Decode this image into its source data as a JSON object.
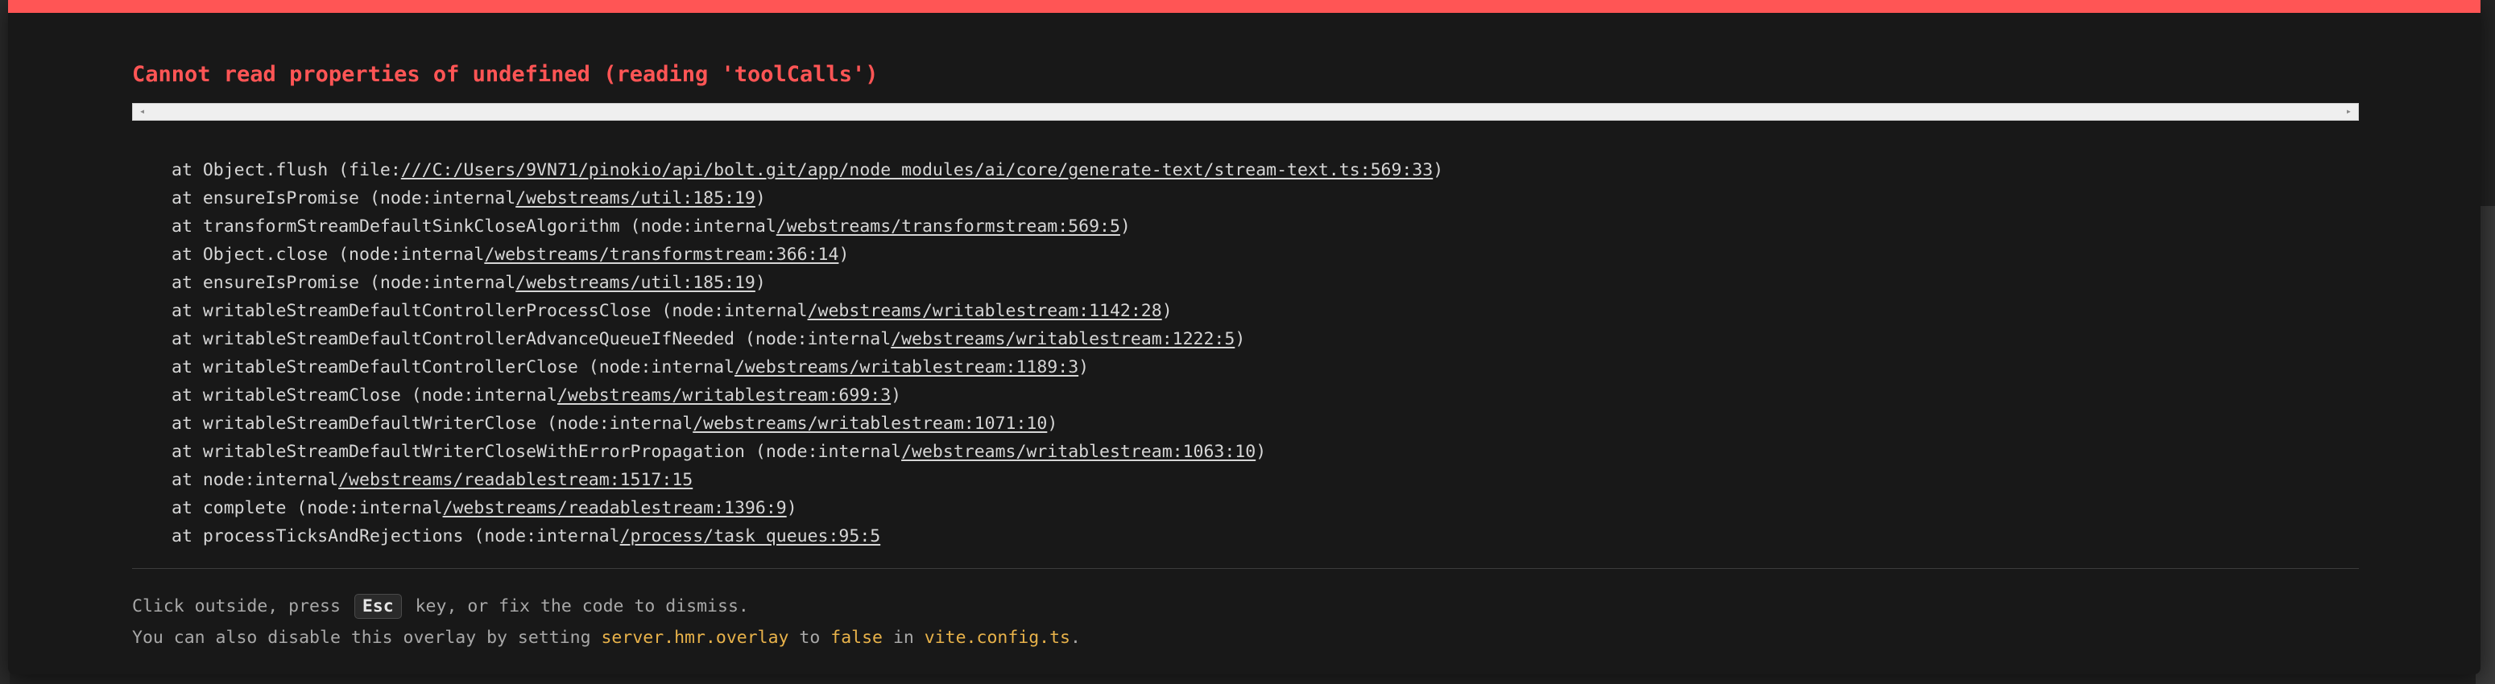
{
  "error": {
    "message": "Cannot read properties of undefined (reading 'toolCalls')"
  },
  "frame": {
    "scroll_left_label": "◂",
    "scroll_right_label": "▸"
  },
  "stack": [
    {
      "prefix": "at Object.flush (file:",
      "link": "///C:/Users/9VN71/pinokio/api/bolt.git/app/node_modules/ai/core/generate-text/stream-text.ts:569:33",
      "suffix": ")"
    },
    {
      "prefix": "at ensureIsPromise (node:internal",
      "link": "/webstreams/util:185:19",
      "suffix": ")"
    },
    {
      "prefix": "at transformStreamDefaultSinkCloseAlgorithm (node:internal",
      "link": "/webstreams/transformstream:569:5",
      "suffix": ")"
    },
    {
      "prefix": "at Object.close (node:internal",
      "link": "/webstreams/transformstream:366:14",
      "suffix": ")"
    },
    {
      "prefix": "at ensureIsPromise (node:internal",
      "link": "/webstreams/util:185:19",
      "suffix": ")"
    },
    {
      "prefix": "at writableStreamDefaultControllerProcessClose (node:internal",
      "link": "/webstreams/writablestream:1142:28",
      "suffix": ")"
    },
    {
      "prefix": "at writableStreamDefaultControllerAdvanceQueueIfNeeded (node:internal",
      "link": "/webstreams/writablestream:1222:5",
      "suffix": ")"
    },
    {
      "prefix": "at writableStreamDefaultControllerClose (node:internal",
      "link": "/webstreams/writablestream:1189:3",
      "suffix": ")"
    },
    {
      "prefix": "at writableStreamClose (node:internal",
      "link": "/webstreams/writablestream:699:3",
      "suffix": ")"
    },
    {
      "prefix": "at writableStreamDefaultWriterClose (node:internal",
      "link": "/webstreams/writablestream:1071:10",
      "suffix": ")"
    },
    {
      "prefix": "at writableStreamDefaultWriterCloseWithErrorPropagation (node:internal",
      "link": "/webstreams/writablestream:1063:10",
      "suffix": ")"
    },
    {
      "prefix": "at node:internal",
      "link": "/webstreams/readablestream:1517:15",
      "suffix": ""
    },
    {
      "prefix": "at complete (node:internal",
      "link": "/webstreams/readablestream:1396:9",
      "suffix": ")"
    },
    {
      "prefix": "at processTicksAndRejections (node:internal",
      "link": "/process/task_queues:95:5",
      "suffix": ""
    }
  ],
  "tips": {
    "line1_before": "Click outside, press ",
    "line1_key": "Esc",
    "line1_after": " key, or fix the code to dismiss.",
    "line2_before": "You can also disable this overlay by setting ",
    "line2_code1": "server.hmr.overlay",
    "line2_mid1": " to ",
    "line2_code2": "false",
    "line2_mid2": " in ",
    "line2_code3": "vite.config.ts",
    "line2_after": "."
  },
  "colors": {
    "accent": "#ff5555",
    "code_highlight": "#e8b24a",
    "background": "#181818"
  }
}
